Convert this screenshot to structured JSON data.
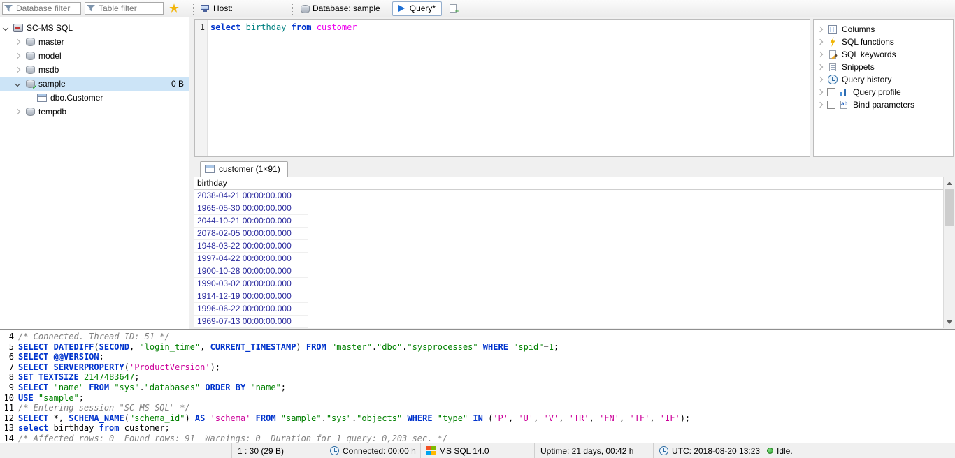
{
  "toolbar": {
    "database_filter_placeholder": "Database filter",
    "table_filter_placeholder": "Table filter",
    "tabs": {
      "host": "Host:",
      "database": "Database: sample",
      "query": "Query*"
    }
  },
  "tree": {
    "items": [
      {
        "label": "SC-MS SQL",
        "level": 0,
        "chevron": "expanded",
        "icon": "server-icon"
      },
      {
        "label": "master",
        "level": 1,
        "chevron": "collapsed",
        "icon": "database-icon"
      },
      {
        "label": "model",
        "level": 1,
        "chevron": "collapsed",
        "icon": "database-icon"
      },
      {
        "label": "msdb",
        "level": 1,
        "chevron": "collapsed",
        "icon": "database-icon"
      },
      {
        "label": "sample",
        "level": 1,
        "chevron": "expanded",
        "icon": "database-selected-icon",
        "selected": true,
        "size": "0 B"
      },
      {
        "label": "dbo.Customer",
        "level": 2,
        "chevron": "none",
        "icon": "table-icon"
      },
      {
        "label": "tempdb",
        "level": 1,
        "chevron": "collapsed",
        "icon": "database-icon"
      }
    ]
  },
  "editor": {
    "lines": [
      {
        "number": "1",
        "tokens": [
          {
            "c": "kw",
            "t": "select"
          },
          {
            "c": "pl",
            "t": " "
          },
          {
            "c": "col",
            "t": "birthday"
          },
          {
            "c": "pl",
            "t": " "
          },
          {
            "c": "kw",
            "t": "from"
          },
          {
            "c": "pl",
            "t": " "
          },
          {
            "c": "tbl",
            "t": "customer"
          }
        ]
      }
    ]
  },
  "helpers": {
    "items": [
      {
        "label": "Columns",
        "icon": "columns-icon",
        "checkbox": false
      },
      {
        "label": "SQL functions",
        "icon": "sql-functions-icon",
        "checkbox": false
      },
      {
        "label": "SQL keywords",
        "icon": "sql-keywords-icon",
        "checkbox": false
      },
      {
        "label": "Snippets",
        "icon": "snippets-icon",
        "checkbox": false
      },
      {
        "label": "Query history",
        "icon": "query-history-icon",
        "checkbox": false
      },
      {
        "label": "Query profile",
        "icon": "query-profile-icon",
        "checkbox": true
      },
      {
        "label": "Bind parameters",
        "icon": "bind-parameters-icon",
        "checkbox": true
      }
    ]
  },
  "results": {
    "tab_label": "customer (1×91)",
    "columns": [
      "birthday"
    ],
    "rows": [
      [
        "2038-04-21 00:00:00.000"
      ],
      [
        "1965-05-30 00:00:00.000"
      ],
      [
        "2044-10-21 00:00:00.000"
      ],
      [
        "2078-02-05 00:00:00.000"
      ],
      [
        "1948-03-22 00:00:00.000"
      ],
      [
        "1997-04-22 00:00:00.000"
      ],
      [
        "1900-10-28 00:00:00.000"
      ],
      [
        "1990-03-02 00:00:00.000"
      ],
      [
        "1914-12-19 00:00:00.000"
      ],
      [
        "1996-06-22 00:00:00.000"
      ],
      [
        "1969-07-13 00:00:00.000"
      ]
    ]
  },
  "log": {
    "lines": [
      {
        "number": "4",
        "tokens": [
          {
            "c": "cmt",
            "t": "/* Connected. Thread-ID: 51 */"
          }
        ]
      },
      {
        "number": "5",
        "tokens": [
          {
            "c": "kw",
            "t": "SELECT"
          },
          {
            "c": "pl",
            "t": " "
          },
          {
            "c": "kw",
            "t": "DATEDIFF"
          },
          {
            "c": "pl",
            "t": "("
          },
          {
            "c": "kw",
            "t": "SECOND"
          },
          {
            "c": "pl",
            "t": ", "
          },
          {
            "c": "id",
            "t": "\"login_time\""
          },
          {
            "c": "pl",
            "t": ", "
          },
          {
            "c": "kw",
            "t": "CURRENT_TIMESTAMP"
          },
          {
            "c": "pl",
            "t": ") "
          },
          {
            "c": "kw",
            "t": "FROM"
          },
          {
            "c": "pl",
            "t": " "
          },
          {
            "c": "id",
            "t": "\"master\""
          },
          {
            "c": "pl",
            "t": "."
          },
          {
            "c": "id",
            "t": "\"dbo\""
          },
          {
            "c": "pl",
            "t": "."
          },
          {
            "c": "id",
            "t": "\"sysprocesses\""
          },
          {
            "c": "pl",
            "t": " "
          },
          {
            "c": "kw",
            "t": "WHERE"
          },
          {
            "c": "pl",
            "t": " "
          },
          {
            "c": "id",
            "t": "\"spid\""
          },
          {
            "c": "pl",
            "t": "="
          },
          {
            "c": "num",
            "t": "1"
          },
          {
            "c": "pl",
            "t": ";"
          }
        ]
      },
      {
        "number": "6",
        "tokens": [
          {
            "c": "kw",
            "t": "SELECT"
          },
          {
            "c": "pl",
            "t": " "
          },
          {
            "c": "kw",
            "t": "@@VERSION"
          },
          {
            "c": "pl",
            "t": ";"
          }
        ]
      },
      {
        "number": "7",
        "tokens": [
          {
            "c": "kw",
            "t": "SELECT"
          },
          {
            "c": "pl",
            "t": " "
          },
          {
            "c": "kw",
            "t": "SERVERPROPERTY"
          },
          {
            "c": "pl",
            "t": "("
          },
          {
            "c": "str",
            "t": "'ProductVersion'"
          },
          {
            "c": "pl",
            "t": ");"
          }
        ]
      },
      {
        "number": "8",
        "tokens": [
          {
            "c": "kw",
            "t": "SET"
          },
          {
            "c": "pl",
            "t": " "
          },
          {
            "c": "kw",
            "t": "TEXTSIZE"
          },
          {
            "c": "pl",
            "t": " "
          },
          {
            "c": "num",
            "t": "2147483647"
          },
          {
            "c": "pl",
            "t": ";"
          }
        ]
      },
      {
        "number": "9",
        "tokens": [
          {
            "c": "kw",
            "t": "SELECT"
          },
          {
            "c": "pl",
            "t": " "
          },
          {
            "c": "id",
            "t": "\"name\""
          },
          {
            "c": "pl",
            "t": " "
          },
          {
            "c": "kw",
            "t": "FROM"
          },
          {
            "c": "pl",
            "t": " "
          },
          {
            "c": "id",
            "t": "\"sys\""
          },
          {
            "c": "pl",
            "t": "."
          },
          {
            "c": "id",
            "t": "\"databases\""
          },
          {
            "c": "pl",
            "t": " "
          },
          {
            "c": "kw",
            "t": "ORDER BY"
          },
          {
            "c": "pl",
            "t": " "
          },
          {
            "c": "id",
            "t": "\"name\""
          },
          {
            "c": "pl",
            "t": ";"
          }
        ]
      },
      {
        "number": "10",
        "tokens": [
          {
            "c": "kw",
            "t": "USE"
          },
          {
            "c": "pl",
            "t": " "
          },
          {
            "c": "id",
            "t": "\"sample\""
          },
          {
            "c": "pl",
            "t": ";"
          }
        ]
      },
      {
        "number": "11",
        "tokens": [
          {
            "c": "cmt",
            "t": "/* Entering session \"SC-MS SQL\" */"
          }
        ]
      },
      {
        "number": "12",
        "tokens": [
          {
            "c": "kw",
            "t": "SELECT"
          },
          {
            "c": "pl",
            "t": " *, "
          },
          {
            "c": "kw",
            "t": "SCHEMA_NAME"
          },
          {
            "c": "pl",
            "t": "("
          },
          {
            "c": "id",
            "t": "\"schema_id\""
          },
          {
            "c": "pl",
            "t": ") "
          },
          {
            "c": "kw",
            "t": "AS"
          },
          {
            "c": "pl",
            "t": " "
          },
          {
            "c": "str",
            "t": "'schema'"
          },
          {
            "c": "pl",
            "t": " "
          },
          {
            "c": "kw",
            "t": "FROM"
          },
          {
            "c": "pl",
            "t": " "
          },
          {
            "c": "id",
            "t": "\"sample\""
          },
          {
            "c": "pl",
            "t": "."
          },
          {
            "c": "id",
            "t": "\"sys\""
          },
          {
            "c": "pl",
            "t": "."
          },
          {
            "c": "id",
            "t": "\"objects\""
          },
          {
            "c": "pl",
            "t": " "
          },
          {
            "c": "kw",
            "t": "WHERE"
          },
          {
            "c": "pl",
            "t": " "
          },
          {
            "c": "id",
            "t": "\"type\""
          },
          {
            "c": "pl",
            "t": " "
          },
          {
            "c": "kw",
            "t": "IN"
          },
          {
            "c": "pl",
            "t": " ("
          },
          {
            "c": "str",
            "t": "'P'"
          },
          {
            "c": "pl",
            "t": ", "
          },
          {
            "c": "str",
            "t": "'U'"
          },
          {
            "c": "pl",
            "t": ", "
          },
          {
            "c": "str",
            "t": "'V'"
          },
          {
            "c": "pl",
            "t": ", "
          },
          {
            "c": "str",
            "t": "'TR'"
          },
          {
            "c": "pl",
            "t": ", "
          },
          {
            "c": "str",
            "t": "'FN'"
          },
          {
            "c": "pl",
            "t": ", "
          },
          {
            "c": "str",
            "t": "'TF'"
          },
          {
            "c": "pl",
            "t": ", "
          },
          {
            "c": "str",
            "t": "'IF'"
          },
          {
            "c": "pl",
            "t": ");"
          }
        ]
      },
      {
        "number": "13",
        "tokens": [
          {
            "c": "kw",
            "t": "select"
          },
          {
            "c": "pl",
            "t": " birthday "
          },
          {
            "c": "kw",
            "t": "from"
          },
          {
            "c": "pl",
            "t": " customer;"
          }
        ]
      },
      {
        "number": "14",
        "tokens": [
          {
            "c": "cmt",
            "t": "/* Affected rows: 0  Found rows: 91  Warnings: 0  Duration for 1 query: 0,203 sec. */"
          }
        ]
      }
    ]
  },
  "statusbar": {
    "cursor_position": "1 : 30 (29 B)",
    "connected": "Connected: 00:00 h",
    "server_version": "MS SQL 14.0",
    "uptime": "Uptime: 21 days, 00:42 h",
    "utc_time": "UTC: 2018-08-20 13:23",
    "state": "Idle."
  },
  "icons": {
    "checkmark": "✓",
    "filter-icon": "funnel-shape",
    "star-icon": "star-shape",
    "host-icon": "monitor-shape",
    "database-icon": "cylinder-shape",
    "query-run-icon": "play-triangle",
    "table-icon": "grid-shape",
    "clock-icon": "clock-face",
    "windows-logo-icon": "four-color-squares",
    "idle-status-icon": "green-dot"
  },
  "colors": {
    "keyword": "#0033cc",
    "identifier": "#008000",
    "number": "#008000",
    "string": "#cc0099",
    "comment": "#808080",
    "table_name": "#ee00ee",
    "column_name": "#008080",
    "datetime_value": "#2a2a9e",
    "selection_bg": "#cce4f7",
    "accent": "#1d6fd5"
  }
}
